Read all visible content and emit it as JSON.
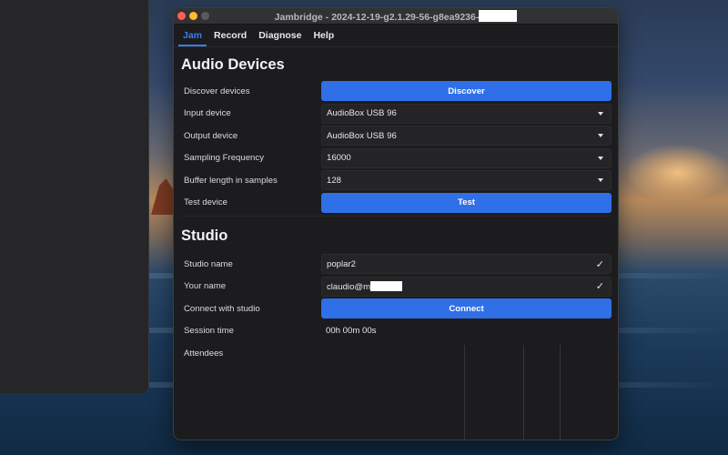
{
  "window": {
    "title": "Jambridge - 2024-12-19-g2.1.29-56-g8ea9236-"
  },
  "menu": {
    "items": [
      {
        "label": "Jam",
        "active": true
      },
      {
        "label": "Record",
        "active": false
      },
      {
        "label": "Diagnose",
        "active": false
      },
      {
        "label": "Help",
        "active": false
      }
    ]
  },
  "audio_devices": {
    "title": "Audio Devices",
    "discover": {
      "label": "Discover devices",
      "button": "Discover"
    },
    "input_device": {
      "label": "Input device",
      "value": "AudioBox USB 96"
    },
    "output_device": {
      "label": "Output device",
      "value": "AudioBox USB 96"
    },
    "sampling": {
      "label": "Sampling Frequency",
      "value": "16000"
    },
    "buffer": {
      "label": "Buffer length in samples",
      "value": "128"
    },
    "test": {
      "label": "Test device",
      "button": "Test"
    }
  },
  "studio": {
    "title": "Studio",
    "studio_name": {
      "label": "Studio name",
      "value": "poplar2"
    },
    "your_name": {
      "label": "Your name",
      "value": "claudio@m"
    },
    "connect": {
      "label": "Connect with studio",
      "button": "Connect"
    },
    "session_time": {
      "label": "Session time",
      "value": "00h 00m 00s"
    },
    "attendees": {
      "label": "Attendees"
    }
  },
  "colors": {
    "accent": "#2f6fe8",
    "active_tab": "#3a7cf0",
    "window_bg": "#1c1c1e"
  }
}
